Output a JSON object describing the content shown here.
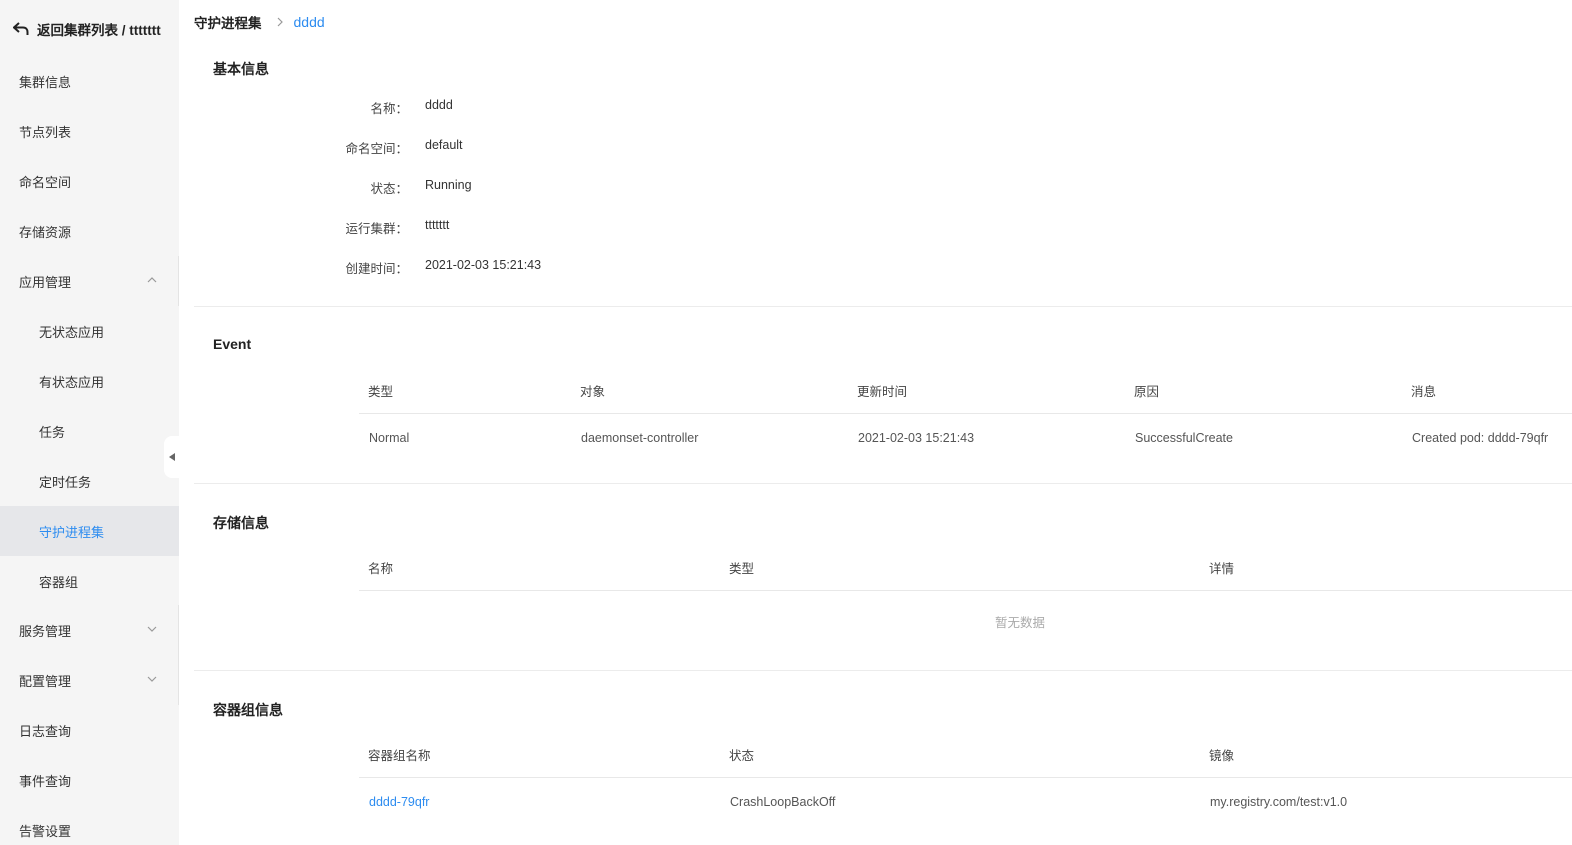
{
  "sidebar": {
    "back_label": "返回集群列表 / ttttttt",
    "items": [
      {
        "label": "集群信息"
      },
      {
        "label": "节点列表"
      },
      {
        "label": "命名空间"
      },
      {
        "label": "存储资源"
      },
      {
        "label": "应用管理",
        "expanded": true
      },
      {
        "label": "无状态应用"
      },
      {
        "label": "有状态应用"
      },
      {
        "label": "任务"
      },
      {
        "label": "定时任务"
      },
      {
        "label": "守护进程集",
        "active": true
      },
      {
        "label": "容器组"
      },
      {
        "label": "服务管理",
        "expanded": false
      },
      {
        "label": "配置管理",
        "expanded": false
      },
      {
        "label": "日志查询"
      },
      {
        "label": "事件查询"
      },
      {
        "label": "告警设置"
      }
    ]
  },
  "breadcrumb": {
    "parent": "守护进程集",
    "current": "dddd"
  },
  "basic_info": {
    "title": "基本信息",
    "rows": [
      {
        "label": "名称：",
        "value": "dddd"
      },
      {
        "label": "命名空间：",
        "value": "default"
      },
      {
        "label": "状态：",
        "value": "Running"
      },
      {
        "label": "运行集群：",
        "value": "ttttttt"
      },
      {
        "label": "创建时间：",
        "value": "2021-02-03 15:21:43"
      }
    ]
  },
  "event": {
    "title": "Event",
    "headers": [
      "类型",
      "对象",
      "更新时间",
      "原因",
      "消息"
    ],
    "rows": [
      [
        "Normal",
        "daemonset-controller",
        "2021-02-03 15:21:43",
        "SuccessfulCreate",
        "Created pod: dddd-79qfr"
      ]
    ]
  },
  "storage": {
    "title": "存储信息",
    "headers": [
      "名称",
      "类型",
      "详情"
    ],
    "empty_text": "暂无数据"
  },
  "pods": {
    "title": "容器组信息",
    "headers": [
      "容器组名称",
      "状态",
      "镜像"
    ],
    "rows": [
      [
        "dddd-79qfr",
        "CrashLoopBackOff",
        "my.registry.com/test:v1.0"
      ]
    ]
  },
  "colors": {
    "accent": "#2d8cf0",
    "sidebar_bg": "#f5f5f5",
    "active_bg": "#e6e7ea"
  }
}
